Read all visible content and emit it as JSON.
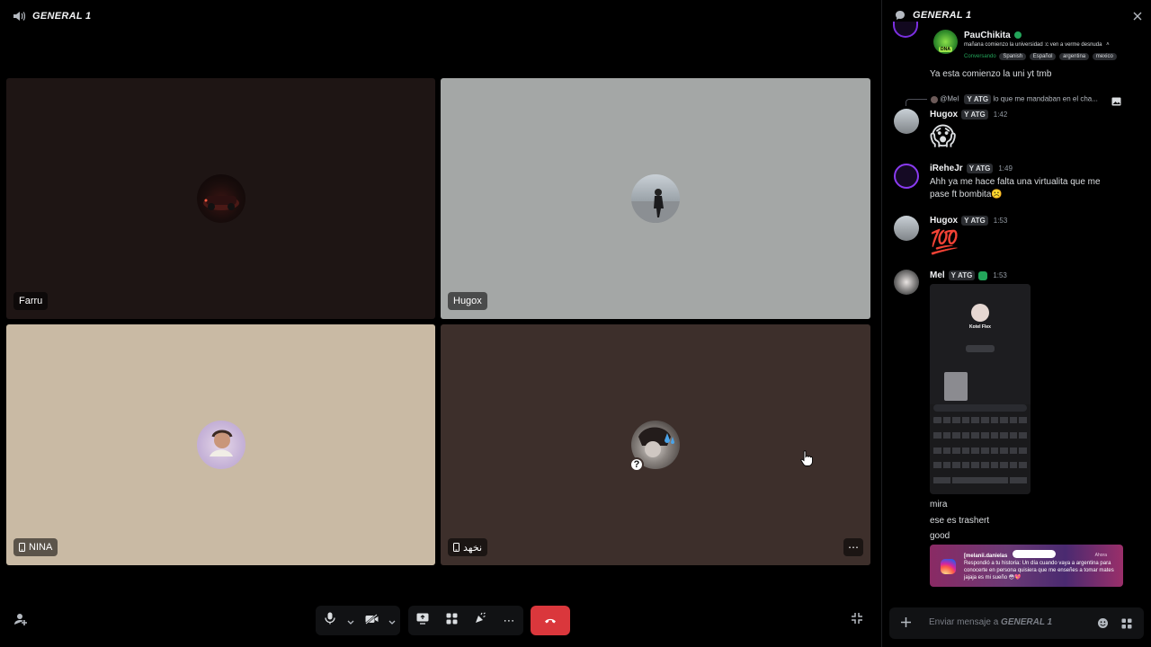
{
  "call": {
    "header_title": "GENERAL 1",
    "tiles": [
      {
        "name": "Farru"
      },
      {
        "name": "Hugox"
      },
      {
        "name": "NINA"
      },
      {
        "name": "نخهد"
      }
    ]
  },
  "chat": {
    "header_title": "GENERAL 1",
    "pinned_profile": {
      "name": "PauChikita",
      "bio": "mañana comienzo la universidad :c ven a verme desnuda",
      "status": "Conversando",
      "pills": [
        "Spanish",
        "Español",
        "argentina",
        "mexico"
      ]
    },
    "messages": [
      {
        "text": "Ya esta comienzo la uni yt tmb"
      },
      {
        "reply_to": "@Mel",
        "reply_tag": "ATG",
        "reply_text": "lo que me mandaban en el cha...",
        "user": "Hugox",
        "tag": "ATG",
        "time": "1:42",
        "emoji": "😱"
      },
      {
        "user": "iReheJr",
        "tag": "ATG",
        "time": "1:49",
        "line1": "Ahh ya me hace falta una virtualita que me",
        "line2": "pase ft bombita",
        "emoji": "☹️"
      },
      {
        "user": "Hugox",
        "tag": "ATG",
        "time": "1:53",
        "emoji": "💯"
      },
      {
        "user": "Mel",
        "tag": "ATG",
        "time": "1:53"
      },
      {
        "text": "mira"
      },
      {
        "text": "ese es trashert"
      },
      {
        "text": "good"
      }
    ],
    "phone_screenshot": {
      "profile_name": "Kotel Flex"
    },
    "instagram_notification": {
      "title": "[melanii.danielas",
      "body": "Respondió a tu historia: Un día cuando vaya a argentina para conocerte en persona quisiera que me enseñes a tomar mates jajaja es mi sueño 😳💖",
      "time": "Ahora"
    },
    "input_placeholder_prefix": "Enviar mensaje a ",
    "input_placeholder_channel": "GENERAL 1"
  },
  "colors": {
    "hangup": "#da373c",
    "verified": "#23a55a"
  }
}
